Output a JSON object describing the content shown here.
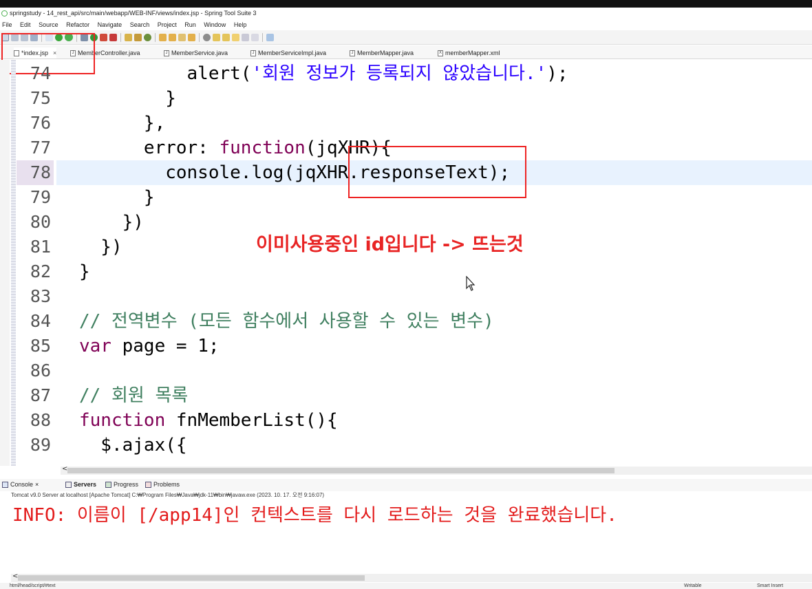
{
  "window": {
    "title": "springstudy - 14_rest_api/src/main/webapp/WEB-INF/views/index.jsp - Spring Tool Suite 3"
  },
  "menu": [
    "File",
    "Edit",
    "Source",
    "Refactor",
    "Navigate",
    "Search",
    "Project",
    "Run",
    "Window",
    "Help"
  ],
  "editor_tabs": [
    {
      "label": "*index.jsp",
      "close": "×"
    },
    {
      "label": "MemberController.java"
    },
    {
      "label": "MemberService.java"
    },
    {
      "label": "MemberServiceImpl.java"
    },
    {
      "label": "MemberMapper.java"
    },
    {
      "label": "memberMapper.xml"
    }
  ],
  "code": {
    "current_line": 78,
    "lines": [
      {
        "n": "74",
        "segments": [
          {
            "c": "pl",
            "t": "          alert("
          },
          {
            "c": "str",
            "t": "'회원 정보가 등록되지 않았습니다.'"
          },
          {
            "c": "pl",
            "t": ");"
          }
        ]
      },
      {
        "n": "75",
        "segments": [
          {
            "c": "pl",
            "t": "        }"
          }
        ]
      },
      {
        "n": "76",
        "segments": [
          {
            "c": "pl",
            "t": "      },"
          }
        ]
      },
      {
        "n": "77",
        "segments": [
          {
            "c": "pl",
            "t": "      error: "
          },
          {
            "c": "kw",
            "t": "function"
          },
          {
            "c": "pl",
            "t": "(jqXHR){"
          }
        ]
      },
      {
        "n": "78",
        "segments": [
          {
            "c": "pl",
            "t": "        console.log(jqXHR.responseText);"
          }
        ]
      },
      {
        "n": "79",
        "segments": [
          {
            "c": "pl",
            "t": "      }"
          }
        ]
      },
      {
        "n": "80",
        "segments": [
          {
            "c": "pl",
            "t": "    })"
          }
        ]
      },
      {
        "n": "81",
        "segments": [
          {
            "c": "pl",
            "t": "  })"
          }
        ]
      },
      {
        "n": "82",
        "segments": [
          {
            "c": "pl",
            "t": "}"
          }
        ]
      },
      {
        "n": "83",
        "segments": [
          {
            "c": "pl",
            "t": ""
          }
        ]
      },
      {
        "n": "84",
        "segments": [
          {
            "c": "cm",
            "t": "// 전역변수 (모든 함수에서 사용할 수 있는 변수)"
          }
        ]
      },
      {
        "n": "85",
        "segments": [
          {
            "c": "kw",
            "t": "var"
          },
          {
            "c": "pl",
            "t": " page = 1;"
          }
        ]
      },
      {
        "n": "86",
        "segments": [
          {
            "c": "pl",
            "t": ""
          }
        ]
      },
      {
        "n": "87",
        "segments": [
          {
            "c": "cm",
            "t": "// 회원 목록"
          }
        ]
      },
      {
        "n": "88",
        "segments": [
          {
            "c": "kw",
            "t": "function"
          },
          {
            "c": "pl",
            "t": " fnMemberList(){"
          }
        ]
      },
      {
        "n": "89",
        "segments": [
          {
            "c": "pl",
            "t": "  $.ajax({"
          }
        ]
      }
    ]
  },
  "annotation": {
    "text": "이미사용중인 id입니다 -> 뜨는것",
    "color": "#e82424"
  },
  "console": {
    "tabs": [
      {
        "label": "Console",
        "close": "×"
      },
      {
        "label": "Servers"
      },
      {
        "label": "Progress"
      },
      {
        "label": "Problems"
      }
    ],
    "description": "Tomcat v9.0 Server at localhost [Apache Tomcat] C:₩Program Files₩Java₩jdk-11₩bin₩javaw.exe  (2023. 10. 17. 오전 9:16:07)",
    "output": "INFO: 이름이 [/app14]인 컨텍스트를 다시 로드하는 것을 완료했습니다.",
    "output_color": "#e31b1b"
  },
  "scroll_arrow": "<",
  "statusbar": {
    "path": "html/head/script/#text",
    "mode": "Writable",
    "insert": "Smart Insert"
  },
  "colors": {
    "keyword": "#7f0055",
    "string": "#2a00ff",
    "comment": "#3f7f5f",
    "current_line": "#e8f2fe",
    "highlight_box": "#ee2222"
  }
}
